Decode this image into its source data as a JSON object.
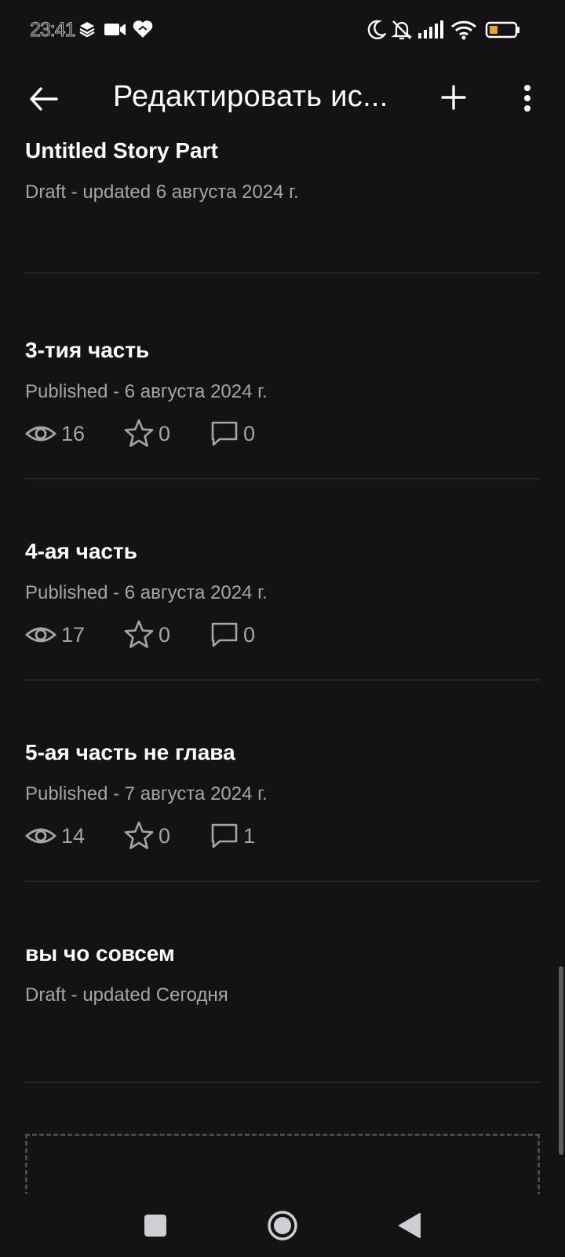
{
  "status_bar": {
    "time": "23:41",
    "icons": [
      "layers-icon",
      "video-icon",
      "heart-icon",
      "moon-icon",
      "bell-off-icon",
      "signal-icon",
      "wifi-icon",
      "battery-icon"
    ],
    "battery_level": "9"
  },
  "app_bar": {
    "title": "Редактировать ис...",
    "back_icon": "arrow-left-icon",
    "add_icon": "plus-icon",
    "more_icon": "more-vertical-icon"
  },
  "parts": [
    {
      "title": "Untitled Story Part",
      "status": "Draft - updated 6 августа 2024 г.",
      "has_stats": false
    },
    {
      "title": "3-тия часть",
      "status": "Published - 6 августа 2024 г.",
      "has_stats": true,
      "stats": {
        "views": "16",
        "votes": "0",
        "comments": "0"
      }
    },
    {
      "title": "4-ая часть",
      "status": "Published - 6 августа 2024 г.",
      "has_stats": true,
      "stats": {
        "views": "17",
        "votes": "0",
        "comments": "0"
      }
    },
    {
      "title": "5-ая  часть не глава",
      "status": "Published - 7 августа 2024 г.",
      "has_stats": true,
      "stats": {
        "views": "14",
        "votes": "0",
        "comments": "1"
      }
    },
    {
      "title": "вы чо совсем",
      "status": "Draft - updated Сегодня",
      "has_stats": false
    }
  ],
  "colors": {
    "background": "#141215",
    "divider": "#3a383b",
    "secondary_text": "#a7a4a9",
    "primary_text": "#ffffff"
  },
  "nav_bar": {
    "icons": [
      "recents-square-icon",
      "home-circle-icon",
      "back-triangle-icon"
    ]
  }
}
